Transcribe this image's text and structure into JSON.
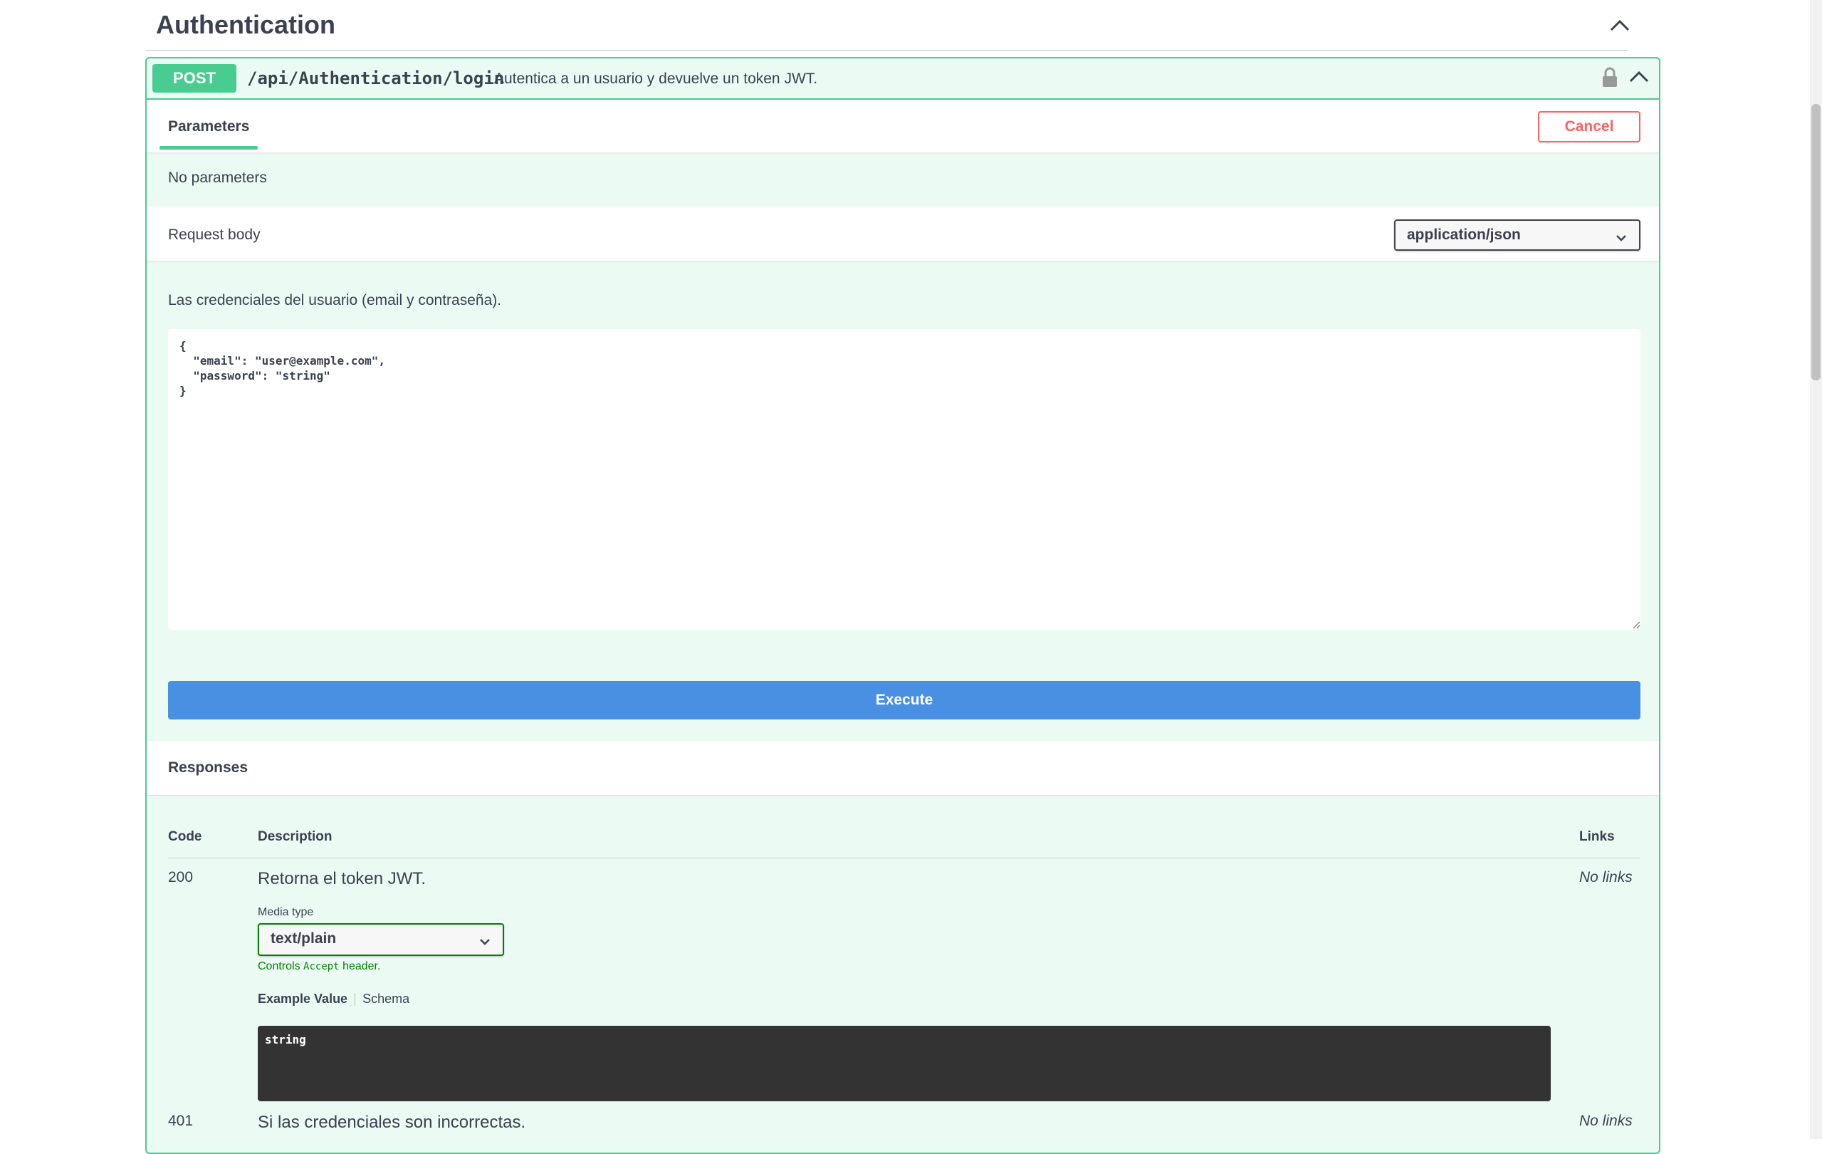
{
  "tag": {
    "title": "Authentication"
  },
  "operation": {
    "method": "POST",
    "path": "/api/Authentication/login",
    "summary": "Autentica a un usuario y devuelve un token JWT."
  },
  "parameters": {
    "tab_label": "Parameters",
    "cancel_label": "Cancel",
    "empty_text": "No parameters"
  },
  "request_body": {
    "label": "Request body",
    "content_type": "application/json",
    "description": "Las credenciales del usuario (email y contraseña).",
    "value": "{\n  \"email\": \"user@example.com\",\n  \"password\": \"string\"\n}"
  },
  "execute_label": "Execute",
  "responses": {
    "title": "Responses",
    "headers": {
      "code": "Code",
      "description": "Description",
      "links": "Links"
    },
    "items": [
      {
        "code": "200",
        "description": "Retorna el token JWT.",
        "links": "No links",
        "media_type_label": "Media type",
        "media_type": "text/plain",
        "controls_prefix": "Controls",
        "controls_code": "Accept",
        "controls_suffix": "header.",
        "example_tab": "Example Value",
        "schema_tab": "Schema",
        "example_value": "string"
      },
      {
        "code": "401",
        "description": "Si las credenciales son incorrectas.",
        "links": "No links"
      }
    ]
  },
  "icons": {
    "collapse": "chevron-up-icon",
    "lock": "lock-icon",
    "dropdown": "chevron-down-icon"
  }
}
